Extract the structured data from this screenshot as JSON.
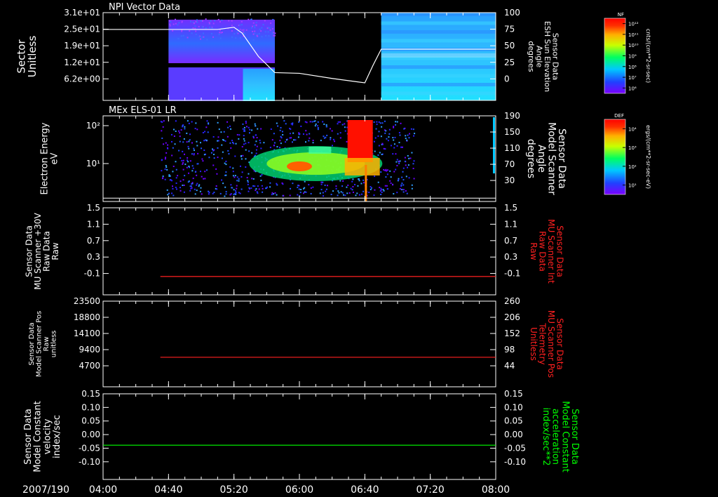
{
  "date_label": "2007/190",
  "time_ticks": [
    "04:00",
    "04:40",
    "05:20",
    "06:00",
    "06:40",
    "07:20",
    "08:00"
  ],
  "colors": {
    "red": "#ff2020",
    "green": "#00ff00",
    "white": "#ffffff"
  },
  "chart_data": [
    {
      "type": "heatmap",
      "title": "NPI Vector Data",
      "ylabel": [
        "Sector",
        "Unitless"
      ],
      "y_ticks": [
        "3.1e+01",
        "2.5e+01",
        "1.9e+01",
        "1.2e+01",
        "6.2e+00"
      ],
      "right_ylabel": [
        "Sensor Data",
        "ESH Sun Elevation",
        "Angle",
        "degrees"
      ],
      "right_ticks": [
        "100",
        "75",
        "50",
        "25",
        "0"
      ],
      "right_ylim": [
        -20,
        100
      ],
      "data_windows": [
        [
          "04:40",
          "05:45"
        ],
        [
          "06:50",
          "08:00"
        ]
      ],
      "line": {
        "name": "ESH Sun Elevation Angle",
        "times": [
          "04:00",
          "04:40",
          "05:10",
          "05:20",
          "05:25",
          "05:35",
          "05:45",
          "06:00",
          "06:20",
          "06:40",
          "06:45",
          "06:50",
          "08:00"
        ],
        "values": [
          77,
          77,
          77,
          80,
          72,
          40,
          18,
          17,
          10,
          4,
          28,
          50,
          50
        ]
      },
      "colorbar": {
        "label": "NF",
        "units": "cnts/(cm**2-sr-sec)",
        "ticks": [
          "10¹²",
          "10¹¹",
          "10¹⁰",
          "10⁹",
          "10⁸",
          "10⁷",
          "10⁶"
        ]
      }
    },
    {
      "type": "heatmap",
      "title": "MEx ELS-01 LR",
      "ylabel": [
        "Electron Energy",
        "eV"
      ],
      "y_ticks": [
        "10²",
        "10¹"
      ],
      "right_ylabel": [
        "Sensor Data",
        "Model Scanner",
        "Angle",
        "degrees"
      ],
      "right_ticks": [
        "190",
        "150",
        "110",
        "70",
        "30"
      ],
      "right_ylim": [
        10,
        190
      ],
      "data_window": [
        "04:35",
        "07:10"
      ],
      "line": {
        "name": "Model Scanner Angle",
        "value": 17
      },
      "colorbar": {
        "label": "DEF",
        "units": "ergs/(cm**2-sr-sec-eV)",
        "ticks": [
          "10⁴",
          "10³",
          "10²",
          "10¹"
        ]
      }
    },
    {
      "type": "line",
      "ylabel": [
        "Sensor Data",
        "MU Scanner +30V",
        "Raw Data",
        "Raw"
      ],
      "y_ticks": [
        "1.5",
        "1.1",
        "0.7",
        "0.3",
        "-0.1"
      ],
      "ylim": [
        -0.4,
        1.5
      ],
      "right_ylabel": [
        "Sensor Data",
        "MU Scanner Int",
        "Raw Data",
        "Raw"
      ],
      "right_ticks": [
        "1.5",
        "1.1",
        "0.7",
        "0.3",
        "-0.1"
      ],
      "series": [
        {
          "x_start": "04:35",
          "x_end": "08:00",
          "value": 0.0
        }
      ]
    },
    {
      "type": "line",
      "ylabel": [
        "Sensor Data",
        "Model Scanner Pos",
        "Raw",
        "unitless"
      ],
      "y_ticks": [
        "23500",
        "18800",
        "14100",
        "9400",
        "4700"
      ],
      "ylim": [
        0,
        23500
      ],
      "right_ylabel": [
        "Sensor Data",
        "MU Scanner Pos",
        "Telemetry",
        "Unitless"
      ],
      "right_ticks": [
        "260",
        "206",
        "152",
        "98",
        "44"
      ],
      "series": [
        {
          "x_start": "04:35",
          "x_end": "08:00",
          "value": 8100
        }
      ]
    },
    {
      "type": "line",
      "ylabel": [
        "Sensor Data",
        "Model Constant",
        "velocity",
        "index/sec"
      ],
      "y_ticks": [
        "0.15",
        "0.10",
        "0.05",
        "0.00",
        "-0.05",
        "-0.10"
      ],
      "ylim": [
        -0.1,
        0.15
      ],
      "right_ylabel": [
        "Sensor Data",
        "Model Constant",
        "acceleration",
        "index/sec**2"
      ],
      "right_ticks": [
        "0.15",
        "0.10",
        "0.05",
        "0.00",
        "-0.05",
        "-0.10"
      ],
      "series": [
        {
          "x_start": "04:00",
          "x_end": "08:00",
          "value": 0.0
        }
      ]
    }
  ]
}
